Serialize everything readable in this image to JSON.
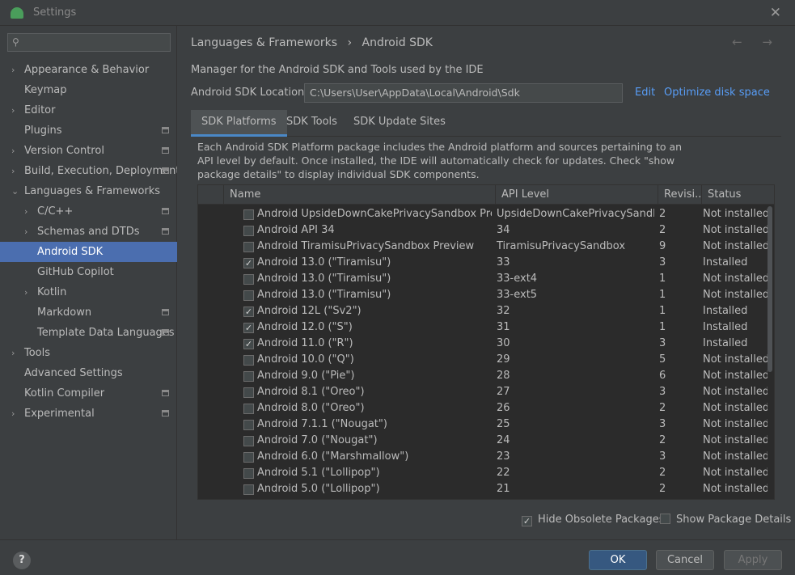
{
  "window": {
    "title": "Settings"
  },
  "sidebar": {
    "search_placeholder": "",
    "items": [
      {
        "label": "Appearance & Behavior",
        "arrow": "›"
      },
      {
        "label": "Keymap",
        "arrow": ""
      },
      {
        "label": "Editor",
        "arrow": "›"
      },
      {
        "label": "Plugins",
        "arrow": ""
      },
      {
        "label": "Version Control",
        "arrow": "›"
      },
      {
        "label": "Build, Execution, Deployment",
        "arrow": "›"
      },
      {
        "label": "Languages & Frameworks",
        "arrow": "⌄"
      },
      {
        "label": "C/C++",
        "arrow": "›"
      },
      {
        "label": "Schemas and DTDs",
        "arrow": "›"
      },
      {
        "label": "Android SDK",
        "arrow": ""
      },
      {
        "label": "GitHub Copilot",
        "arrow": ""
      },
      {
        "label": "Kotlin",
        "arrow": "›"
      },
      {
        "label": "Markdown",
        "arrow": ""
      },
      {
        "label": "Template Data Languages",
        "arrow": ""
      },
      {
        "label": "Tools",
        "arrow": "›"
      },
      {
        "label": "Advanced Settings",
        "arrow": ""
      },
      {
        "label": "Kotlin Compiler",
        "arrow": ""
      },
      {
        "label": "Experimental",
        "arrow": "›"
      }
    ]
  },
  "header": {
    "breadcrumb_parent": "Languages & Frameworks",
    "breadcrumb_sep": "›",
    "breadcrumb_current": "Android SDK",
    "nav": "← →"
  },
  "main": {
    "description": "Manager for the Android SDK and Tools used by the IDE",
    "location_label": "Android SDK Location:",
    "location_value": "C:\\Users\\User\\AppData\\Local\\Android\\Sdk",
    "edit_link": "Edit",
    "optimize_link": "Optimize disk space",
    "tabs": [
      {
        "label": "SDK Platforms"
      },
      {
        "label": "SDK Tools"
      },
      {
        "label": "SDK Update Sites"
      }
    ],
    "note": "Each Android SDK Platform package includes the Android platform and sources pertaining to an API level by default. Once installed, the IDE will automatically check for updates. Check \"show package details\" to display individual SDK components.",
    "table": {
      "headers": {
        "name": "Name",
        "api": "API Level",
        "revision": "Revisi...",
        "status": "Status"
      },
      "rows": [
        {
          "check": "",
          "name": "Android UpsideDownCakePrivacySandbox Preview",
          "api": "UpsideDownCakePrivacySandbox",
          "rev": "2",
          "status": "Not installed"
        },
        {
          "check": "",
          "name": "Android API 34",
          "api": "34",
          "rev": "2",
          "status": "Not installed"
        },
        {
          "check": "",
          "name": "Android TiramisuPrivacySandbox Preview",
          "api": "TiramisuPrivacySandbox",
          "rev": "9",
          "status": "Not installed"
        },
        {
          "check": "✓",
          "name": "Android 13.0 (\"Tiramisu\")",
          "api": "33",
          "rev": "3",
          "status": "Installed"
        },
        {
          "check": "",
          "name": "Android 13.0 (\"Tiramisu\")",
          "api": "33-ext4",
          "rev": "1",
          "status": "Not installed"
        },
        {
          "check": "",
          "name": "Android 13.0 (\"Tiramisu\")",
          "api": "33-ext5",
          "rev": "1",
          "status": "Not installed"
        },
        {
          "check": "✓",
          "name": "Android 12L (\"Sv2\")",
          "api": "32",
          "rev": "1",
          "status": "Installed"
        },
        {
          "check": "✓",
          "name": "Android 12.0 (\"S\")",
          "api": "31",
          "rev": "1",
          "status": "Installed"
        },
        {
          "check": "✓",
          "name": "Android 11.0 (\"R\")",
          "api": "30",
          "rev": "3",
          "status": "Installed"
        },
        {
          "check": "",
          "name": "Android 10.0 (\"Q\")",
          "api": "29",
          "rev": "5",
          "status": "Not installed"
        },
        {
          "check": "",
          "name": "Android 9.0 (\"Pie\")",
          "api": "28",
          "rev": "6",
          "status": "Not installed"
        },
        {
          "check": "",
          "name": "Android 8.1 (\"Oreo\")",
          "api": "27",
          "rev": "3",
          "status": "Not installed"
        },
        {
          "check": "",
          "name": "Android 8.0 (\"Oreo\")",
          "api": "26",
          "rev": "2",
          "status": "Not installed"
        },
        {
          "check": "",
          "name": "Android 7.1.1 (\"Nougat\")",
          "api": "25",
          "rev": "3",
          "status": "Not installed"
        },
        {
          "check": "",
          "name": "Android 7.0 (\"Nougat\")",
          "api": "24",
          "rev": "2",
          "status": "Not installed"
        },
        {
          "check": "",
          "name": "Android 6.0 (\"Marshmallow\")",
          "api": "23",
          "rev": "3",
          "status": "Not installed"
        },
        {
          "check": "",
          "name": "Android 5.1 (\"Lollipop\")",
          "api": "22",
          "rev": "2",
          "status": "Not installed"
        },
        {
          "check": "",
          "name": "Android 5.0 (\"Lollipop\")",
          "api": "21",
          "rev": "2",
          "status": "Not installed"
        }
      ]
    },
    "hide_obsolete": {
      "label": "Hide Obsolete Packages",
      "check": "✓"
    },
    "show_details": {
      "label": "Show Package Details",
      "check": ""
    }
  },
  "footer": {
    "help": "?",
    "ok": "OK",
    "cancel": "Cancel",
    "apply": "Apply"
  }
}
